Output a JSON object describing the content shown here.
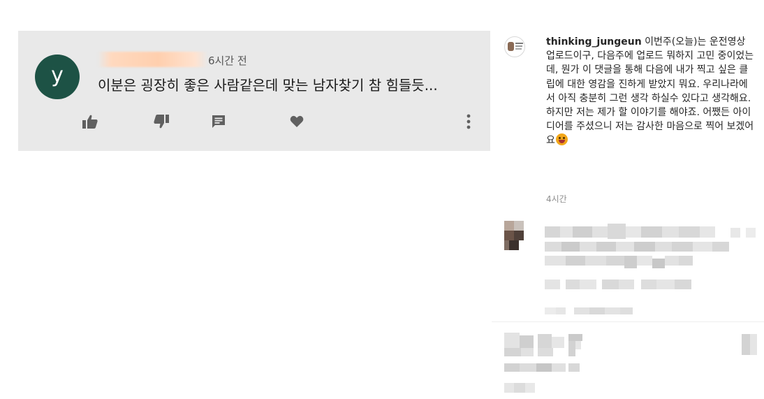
{
  "youtube_comment": {
    "avatar_letter": "y",
    "timestamp": "6시간 전",
    "text": "이분은 굉장히 좋은 사람같은데 맞는 남자찾기 참 힘들듯...",
    "actions": [
      {
        "name": "like",
        "icon": "thumbs-up-icon"
      },
      {
        "name": "dislike",
        "icon": "thumbs-down-icon"
      },
      {
        "name": "reply",
        "icon": "comment-icon"
      },
      {
        "name": "heart",
        "icon": "heart-icon"
      },
      {
        "name": "more",
        "icon": "more-vertical-icon"
      }
    ],
    "colors": {
      "card_bg": "#e9e9e9",
      "avatar_bg": "#1d5245",
      "icon": "#606060"
    }
  },
  "instagram_reply": {
    "username": "thinking_jungeun",
    "caption": "이번주(오늘)는 운전영상 업로드이구, 다음주에 업로드 뭐하지 고민 중이었는데, 뭔가 이 댓글을 통해 다음에 내가 찍고 싶은 클립에 대한 영감을 진하게 받았지 뭐요. 우리나라에서 아직 충분히 그런 생각 하실수 있다고 생각해요. 하지만 저는 제가 할 이야기를 해야죠. 어쨌든 아이디어를 주셨으니 저는 감사한 마음으로 찍어 보겠어요",
    "emoji": "grinning-squinting-face",
    "time": "4시간",
    "colors": {
      "username": "#262626",
      "text": "#262626",
      "meta": "#8e8e8e"
    }
  }
}
